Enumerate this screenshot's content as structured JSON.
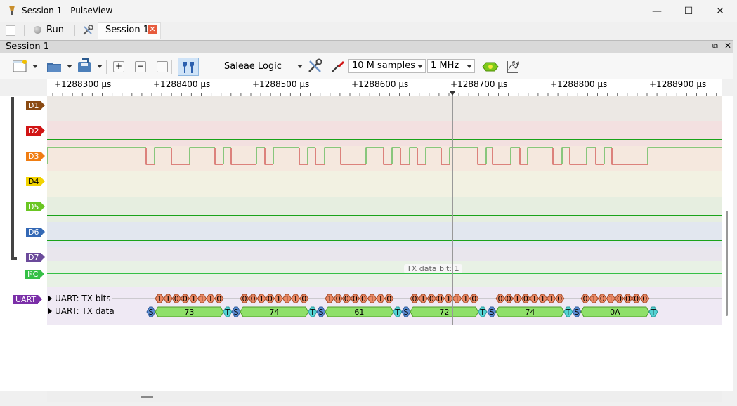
{
  "window": {
    "title": "Session 1 - PulseView",
    "minimize": "—",
    "maximize": "☐",
    "close": "✕"
  },
  "tabbar": {
    "run_label": "Run",
    "session_tab": "Session 1",
    "close_glyph": "✕"
  },
  "session_header": {
    "label": "Session 1",
    "restore_glyph": "⧉",
    "close_glyph": "✕"
  },
  "toolbar": {
    "device": "Saleae Logic",
    "samples": "10 M samples",
    "samplerate": "1 MHz"
  },
  "ruler": {
    "ticks": [
      "+1288300 µs",
      "+1288400 µs",
      "+1288500 µs",
      "+1288600 µs",
      "+1288700 µs",
      "+1288800 µs",
      "+1288900 µs"
    ]
  },
  "channels": [
    {
      "name": "D1",
      "color": "#8a4a12",
      "bg": "#ece8e4"
    },
    {
      "name": "D2",
      "color": "#d11414",
      "bg": "#f3e0e0"
    },
    {
      "name": "D3",
      "color": "#f07d12",
      "bg": "#f5e8de"
    },
    {
      "name": "D4",
      "color": "#f2d300",
      "bg": "#f2f1e2"
    },
    {
      "name": "D5",
      "color": "#6ac622",
      "bg": "#e6eee0"
    },
    {
      "name": "D6",
      "color": "#3368b5",
      "bg": "#e2e7ef"
    },
    {
      "name": "D7",
      "color": "#6b4a9b",
      "bg": "#e9e6ed"
    }
  ],
  "i2c": {
    "label": "I²C",
    "color": "#35c046",
    "bg": "#e8f1e5",
    "tooltip": "TX data bit: 1"
  },
  "uart": {
    "label": "UART",
    "color": "#7b2fa8",
    "rows": [
      {
        "title": "UART: TX bits"
      },
      {
        "title": "UART: TX data"
      }
    ],
    "bits": [
      "1 1 0 0 1 1 1 0",
      "0 0 1 0 1 1 1 0",
      "1 0 0 0 0 1 1 0",
      "0 1 0 0 1 1 1 0",
      "0 0 1 0 1 1 1 0",
      "0 1 0 1 0 0 0 0"
    ],
    "bytes": [
      "73",
      "74",
      "61",
      "72",
      "74",
      "0A"
    ],
    "start_label": "S",
    "stop_label": "T"
  },
  "colors": {
    "bit_fill": "#ec8a66",
    "byte_fill": "#8fe06a",
    "start_fill": "#5d8fd6",
    "stop_fill": "#53d3d3",
    "trace_green": "#1aa31a",
    "trace_red": "#c21b1b"
  }
}
